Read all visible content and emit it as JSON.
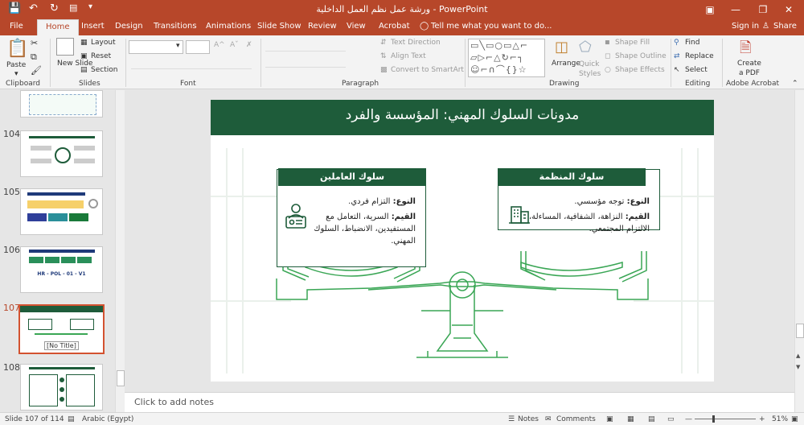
{
  "window": {
    "title": "ورشة عمل نظم العمل الداخلية - PowerPoint",
    "accent": "#b7472a"
  },
  "tabs": [
    "File",
    "Home",
    "Insert",
    "Design",
    "Transitions",
    "Animations",
    "Slide Show",
    "Review",
    "View",
    "Acrobat"
  ],
  "tell_me": "Tell me what you want to do...",
  "account": {
    "sign_in": "Sign in",
    "share": "Share"
  },
  "ribbon": {
    "clipboard": {
      "label": "Clipboard",
      "paste": "Paste"
    },
    "slides": {
      "label": "Slides",
      "new_slide": "New Slide",
      "layout": "Layout",
      "reset": "Reset",
      "section": "Section"
    },
    "font": {
      "label": "Font"
    },
    "paragraph": {
      "label": "Paragraph",
      "text_direction": "Text Direction",
      "align_text": "Align Text",
      "smartart": "Convert to SmartArt"
    },
    "drawing": {
      "label": "Drawing",
      "arrange": "Arrange",
      "quick_styles": "Quick Styles",
      "shape_fill": "Shape Fill",
      "shape_outline": "Shape Outline",
      "shape_effects": "Shape Effects"
    },
    "editing": {
      "label": "Editing",
      "find": "Find",
      "replace": "Replace",
      "select": "Select"
    },
    "acrobat": {
      "label": "Adobe Acrobat",
      "create_pdf": "Create a PDF"
    }
  },
  "thumbnails": [
    {
      "num": "104"
    },
    {
      "num": "105"
    },
    {
      "num": "106",
      "code": "HR - POL - 01 - V1"
    },
    {
      "num": "107",
      "tooltip": "[No Title]"
    },
    {
      "num": "108"
    }
  ],
  "slide": {
    "title": "مدونات السلوك المهني: المؤسسة والفرد",
    "org_card": {
      "header": "سلوك المنظمة",
      "type_label": "النوع:",
      "type_value": "توجه مؤسسي.",
      "values_label": "القيم:",
      "values_value": "النزاهة، الشفافية، المساءلة، الالتزام المجتمعي."
    },
    "emp_card": {
      "header": "سلوك العاملين",
      "type_label": "النوع:",
      "type_value": "التزام فردي.",
      "values_label": "القيم:",
      "values_value": "السرية، التعامل مع المستفيدين، الانضباط، السلوك المهني."
    },
    "brand": "#1e5c3a",
    "scale_line": "#3aa655"
  },
  "notes": {
    "placeholder": "Click to add notes"
  },
  "status": {
    "slide_info": "Slide 107 of 114",
    "language": "Arabic (Egypt)",
    "notes": "Notes",
    "comments": "Comments",
    "zoom": "51%"
  }
}
